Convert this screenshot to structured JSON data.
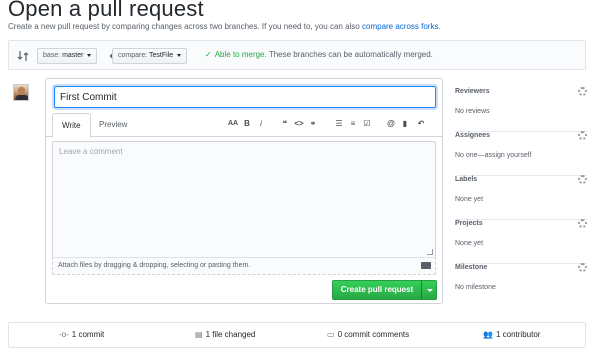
{
  "header": {
    "title": "Open a pull request",
    "subtitle_prefix": "Create a new pull request by comparing changes across two branches. If you need to, you can also",
    "subtitle_link": "compare across forks",
    "subtitle_suffix": "."
  },
  "compare": {
    "base_prefix": "base:",
    "base_branch": "master",
    "compare_prefix": "compare:",
    "compare_branch": "TestFile",
    "merge_ok": "Able to merge.",
    "merge_text": "These branches can be automatically merged."
  },
  "form": {
    "title_value": "First Commit",
    "tab_write": "Write",
    "tab_preview": "Preview",
    "comment_placeholder": "Leave a comment",
    "attach_text": "Attach files by dragging & dropping, selecting or pasting them.",
    "submit_label": "Create pull request"
  },
  "toolbar": {
    "heading": "AA",
    "bold": "B",
    "italic": "i",
    "quote": "❝",
    "code": "<>",
    "link": "⚭",
    "ul": "☰",
    "ol": "≡",
    "task": "☑",
    "mention": "@",
    "bookmark": "▮",
    "reply": "↶"
  },
  "sidebar": {
    "sections": [
      {
        "heading": "Reviewers",
        "value": "No reviews"
      },
      {
        "heading": "Assignees",
        "value": "No one—assign yourself"
      },
      {
        "heading": "Labels",
        "value": "None yet"
      },
      {
        "heading": "Projects",
        "value": "None yet"
      },
      {
        "heading": "Milestone",
        "value": "No milestone"
      }
    ]
  },
  "stats": {
    "commits": "1 commit",
    "files": "1 file changed",
    "comments": "0 commit comments",
    "contributors": "1 contributor"
  },
  "colors": {
    "accent": "#0366d6",
    "success": "#28a745",
    "border": "#d1d5da"
  }
}
